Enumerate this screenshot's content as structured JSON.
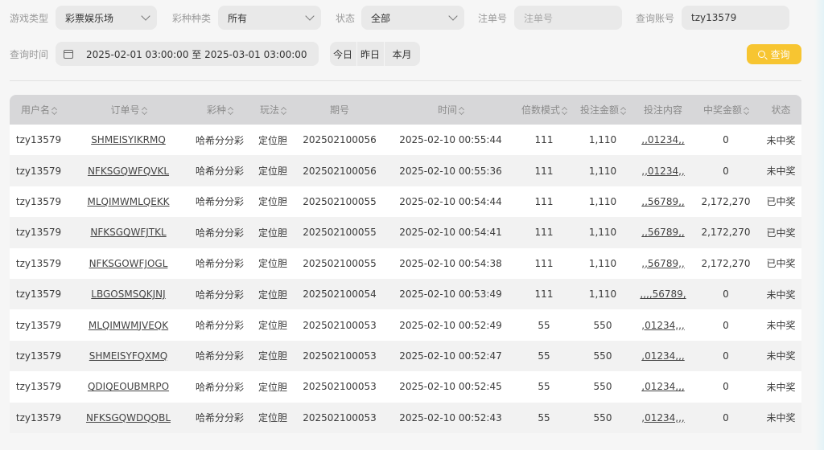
{
  "filters": {
    "game_type_label": "游戏类型",
    "game_type_value": "彩票娱乐场",
    "lottery_type_label": "彩种种类",
    "lottery_type_value": "所有",
    "status_label": "状态",
    "status_value": "全部",
    "order_label": "注单号",
    "order_placeholder": "注单号",
    "account_label": "查询账号",
    "account_value": "tzy13579",
    "time_label": "查询时间",
    "time_range": "2025-02-01 03:00:00 至 2025-03-01 03:00:00",
    "quick": [
      "今日",
      "昨日",
      "本月"
    ],
    "search_label": "查询"
  },
  "table": {
    "columns": [
      "用户名",
      "订单号",
      "彩种",
      "玩法",
      "期号",
      "时间",
      "倍数模式",
      "投注金额",
      "投注内容",
      "中奖金额",
      "状态"
    ],
    "rows": [
      [
        "tzy13579",
        "SHMEISYIKRMQ",
        "哈希分分彩",
        "定位胆",
        "202502100056",
        "2025-02-10 00:55:44",
        "111",
        "1,110",
        ",,01234,,",
        "0",
        "未中奖"
      ],
      [
        "tzy13579",
        "NFKSGQWFQVKL",
        "哈希分分彩",
        "定位胆",
        "202502100056",
        "2025-02-10 00:55:36",
        "111",
        "1,110",
        ",,01234,,",
        "0",
        "未中奖"
      ],
      [
        "tzy13579",
        "MLQIMWMLQEKK",
        "哈希分分彩",
        "定位胆",
        "202502100055",
        "2025-02-10 00:54:44",
        "111",
        "1,110",
        ",,56789,,",
        "2,172,270",
        "已中奖"
      ],
      [
        "tzy13579",
        "NFKSGQWFJTKL",
        "哈希分分彩",
        "定位胆",
        "202502100055",
        "2025-02-10 00:54:41",
        "111",
        "1,110",
        ",,56789,,",
        "2,172,270",
        "已中奖"
      ],
      [
        "tzy13579",
        "NFKSGOWFJOGL",
        "哈希分分彩",
        "定位胆",
        "202502100055",
        "2025-02-10 00:54:38",
        "111",
        "1,110",
        ",,56789,,",
        "2,172,270",
        "已中奖"
      ],
      [
        "tzy13579",
        "LBGOSMSQKJNJ",
        "哈希分分彩",
        "定位胆",
        "202502100054",
        "2025-02-10 00:53:49",
        "111",
        "1,110",
        ",,,,56789,",
        "0",
        "未中奖"
      ],
      [
        "tzy13579",
        "MLQIMWMJVEQK",
        "哈希分分彩",
        "定位胆",
        "202502100053",
        "2025-02-10 00:52:49",
        "55",
        "550",
        ",01234,,,",
        "0",
        "未中奖"
      ],
      [
        "tzy13579",
        "SHMEISYFQXMQ",
        "哈希分分彩",
        "定位胆",
        "202502100053",
        "2025-02-10 00:52:47",
        "55",
        "550",
        ",01234,,,",
        "0",
        "未中奖"
      ],
      [
        "tzy13579",
        "QDIQEOUBMRPO",
        "哈希分分彩",
        "定位胆",
        "202502100053",
        "2025-02-10 00:52:45",
        "55",
        "550",
        ",01234,,,",
        "0",
        "未中奖"
      ],
      [
        "tzy13579",
        "NFKSGQWDQQBL",
        "哈希分分彩",
        "定位胆",
        "202502100053",
        "2025-02-10 00:52:43",
        "55",
        "550",
        ",01234,,,",
        "0",
        "未中奖"
      ]
    ]
  }
}
